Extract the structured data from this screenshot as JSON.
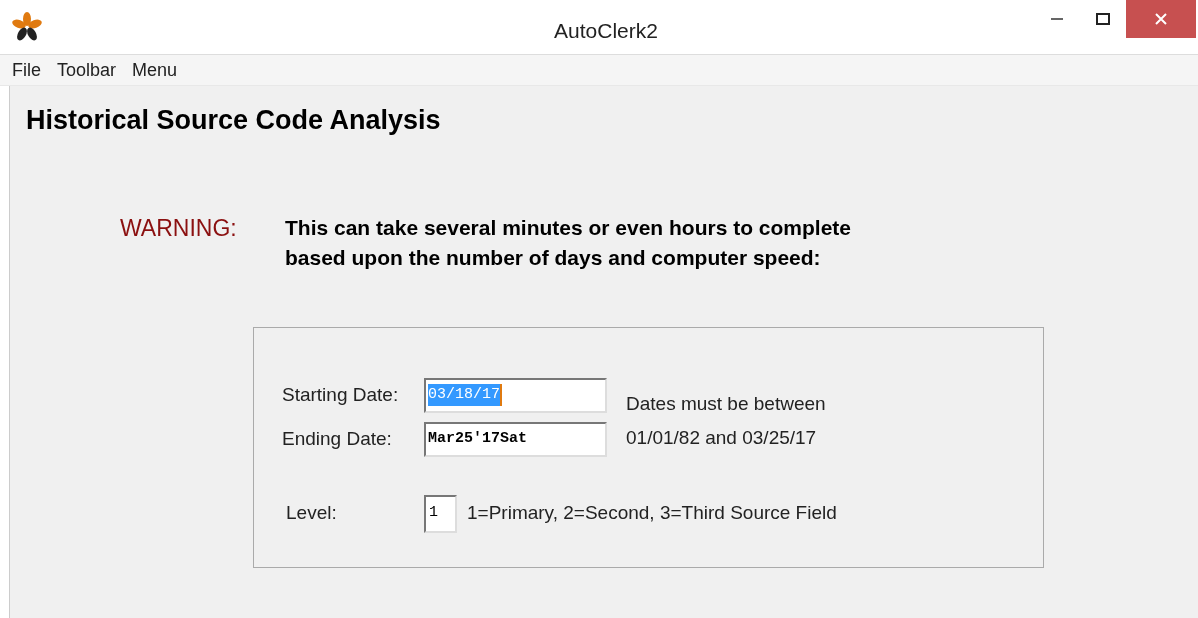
{
  "window": {
    "title": "AutoClerk2"
  },
  "menu": [
    "File",
    "Toolbar",
    "Menu"
  ],
  "heading": "Historical Source Code Analysis",
  "warning": {
    "label": "WARNING:",
    "lines": [
      "This can take several minutes or even hours to complete",
      "based upon the number of days and computer speed:"
    ]
  },
  "form": {
    "fields": [
      {
        "label": "Starting Date:",
        "value": "03/18/17",
        "selected": true
      },
      {
        "label": "Ending Date:",
        "value": "Mar25'17Sat",
        "selected": false
      }
    ],
    "note": [
      "Dates must be between",
      "01/01/82 and 03/25/17"
    ],
    "level": {
      "label": "Level:",
      "value": "1",
      "hint": "1=Primary, 2=Second, 3=Third Source Field"
    }
  }
}
